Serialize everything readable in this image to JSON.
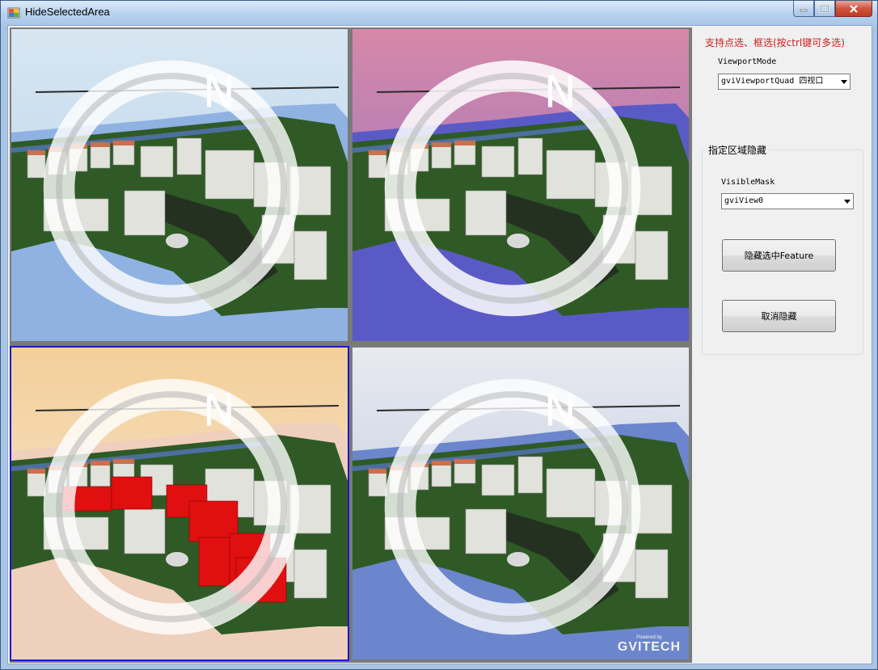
{
  "window": {
    "title": "HideSelectedArea"
  },
  "viewports": {
    "mode_label": "ViewportMode",
    "mode_value": "gviViewportQuad  四视口",
    "views": [
      {
        "name": "view-0",
        "sky_top": "#d7e6f1",
        "sky_bottom": "#b6d2ec",
        "water": "#8fb2e3",
        "active": false
      },
      {
        "name": "view-1",
        "sky_top": "#d688a8",
        "sky_bottom": "#8a72c8",
        "water": "#5a5ac6",
        "active": false
      },
      {
        "name": "view-2",
        "sky_top": "#f3cf9a",
        "sky_bottom": "#f6ead8",
        "water": "#efd0bc",
        "active": true
      },
      {
        "name": "view-3",
        "sky_top": "#e8eaf0",
        "sky_bottom": "#b4c0dc",
        "water": "#6b86cc",
        "active": false
      }
    ],
    "brand": {
      "powered": "Powered by",
      "name": "GVITECH"
    }
  },
  "panel": {
    "hint": "支持点选、框选(按ctrl键可多选)",
    "group_title": "指定区域隐藏",
    "mask_label": "VisibleMask",
    "mask_value": "gviView0",
    "hide_button": "隐藏选中Feature",
    "cancel_button": "取消隐藏"
  },
  "colors": {
    "hint": "#d21c1c",
    "selection": "#e01010",
    "active_border": "#1a1acc"
  }
}
